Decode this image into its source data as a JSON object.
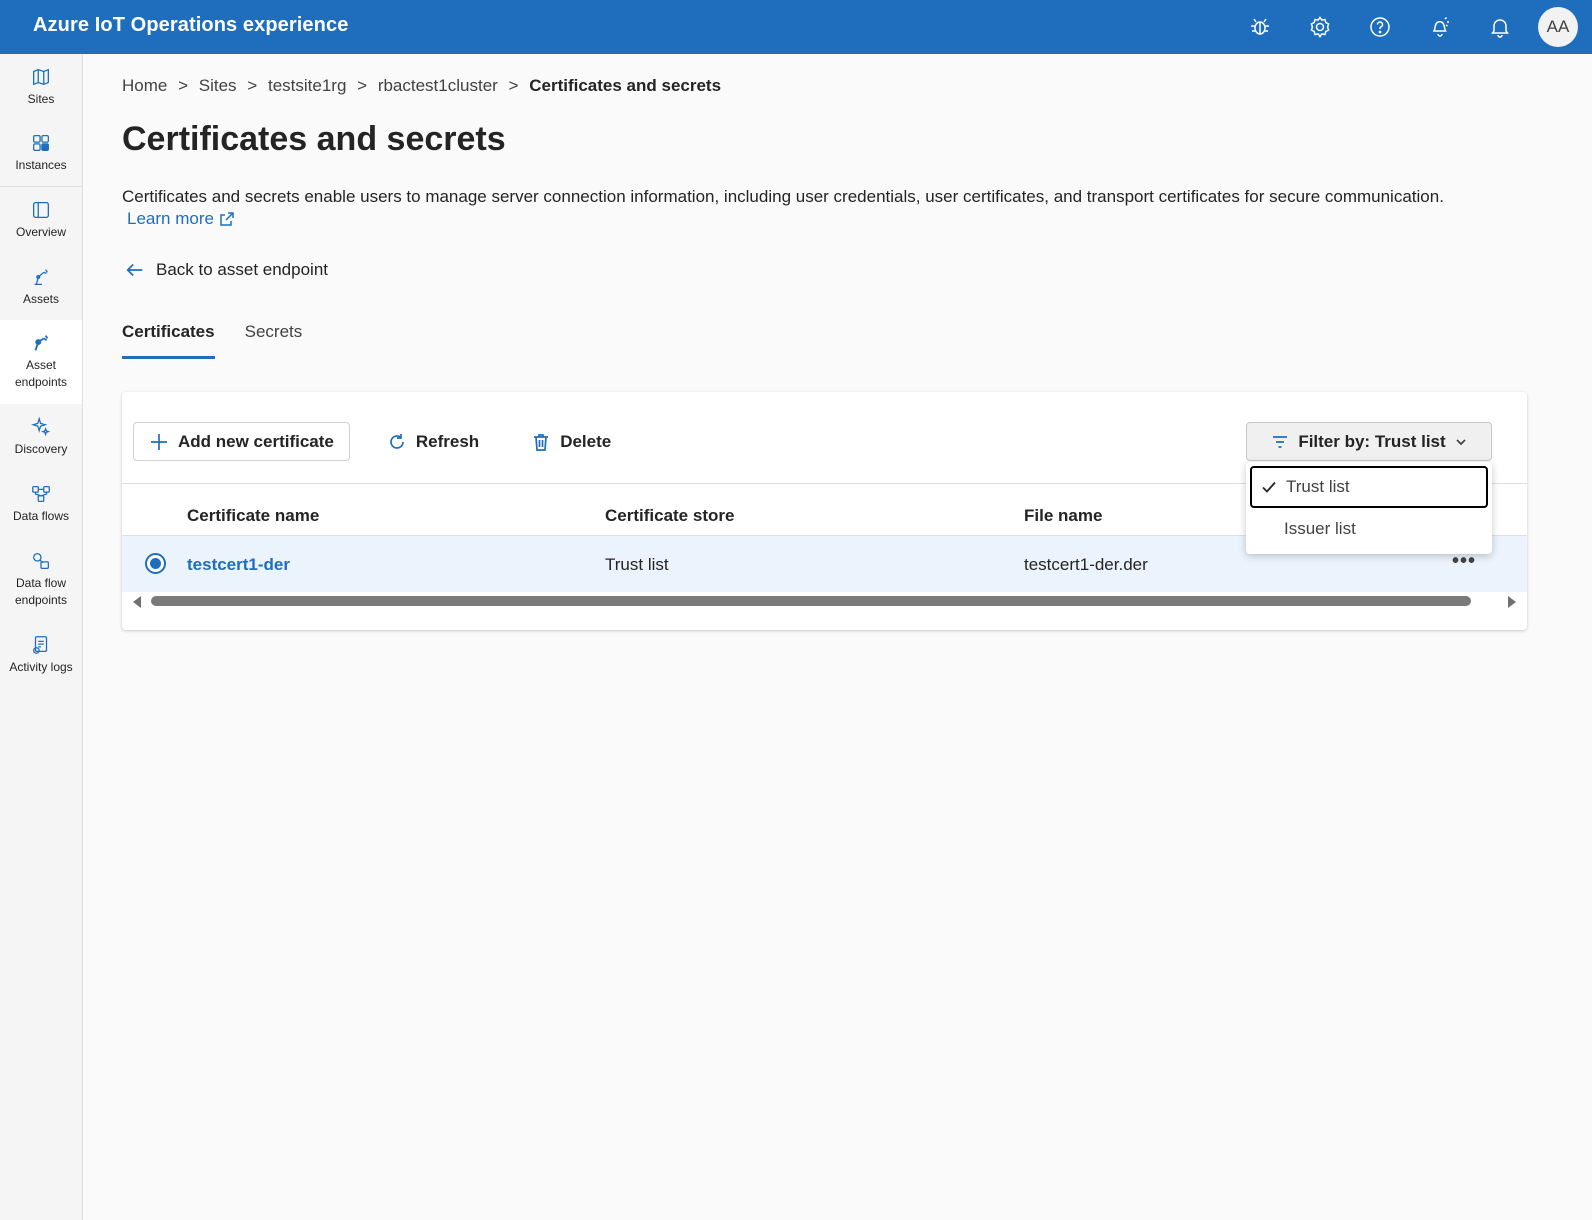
{
  "app": {
    "title": "Azure IoT Operations experience",
    "avatar_initials": "AA"
  },
  "topbar_icons": [
    "bug-icon",
    "gear-icon",
    "help-icon",
    "feedback-icon",
    "notification-bell-icon"
  ],
  "nav": {
    "items": [
      {
        "label": "Sites"
      },
      {
        "label": "Instances"
      },
      {
        "label": "Overview"
      },
      {
        "label": "Assets"
      },
      {
        "label": "Asset endpoints"
      },
      {
        "label": "Discovery"
      },
      {
        "label": "Data flows"
      },
      {
        "label": "Data flow endpoints"
      },
      {
        "label": "Activity logs"
      }
    ],
    "active": "Asset endpoints"
  },
  "breadcrumb": [
    "Home",
    ">",
    "Sites",
    ">",
    "testsite1rg",
    ">",
    "rbactest1cluster",
    ">",
    "Certificates and secrets"
  ],
  "page": {
    "title": "Certificates and secrets",
    "description": "Certificates and secrets enable users to manage server connection information, including user credentials, user certificates, and transport certificates for secure communication.",
    "learn_more": "Learn more",
    "back_link": "Back to asset endpoint"
  },
  "tabs": [
    {
      "label": "Certificates",
      "active": true
    },
    {
      "label": "Secrets",
      "active": false
    }
  ],
  "toolbar": {
    "add_label": "Add new certificate",
    "refresh_label": "Refresh",
    "delete_label": "Delete",
    "filter_label": "Filter by: Trust list"
  },
  "table": {
    "columns": [
      "Certificate name",
      "Certificate store",
      "File name"
    ],
    "rows": [
      {
        "name": "testcert1-der",
        "store": "Trust list",
        "file": "testcert1-der.der",
        "selected": true
      }
    ],
    "more_label": "•••"
  },
  "filter_dropdown": {
    "options": [
      "Trust list",
      "Issuer list"
    ],
    "selected": "Trust list"
  },
  "colors": {
    "accent": "#1e6ebd",
    "selected_row": "#ebf3fc"
  }
}
